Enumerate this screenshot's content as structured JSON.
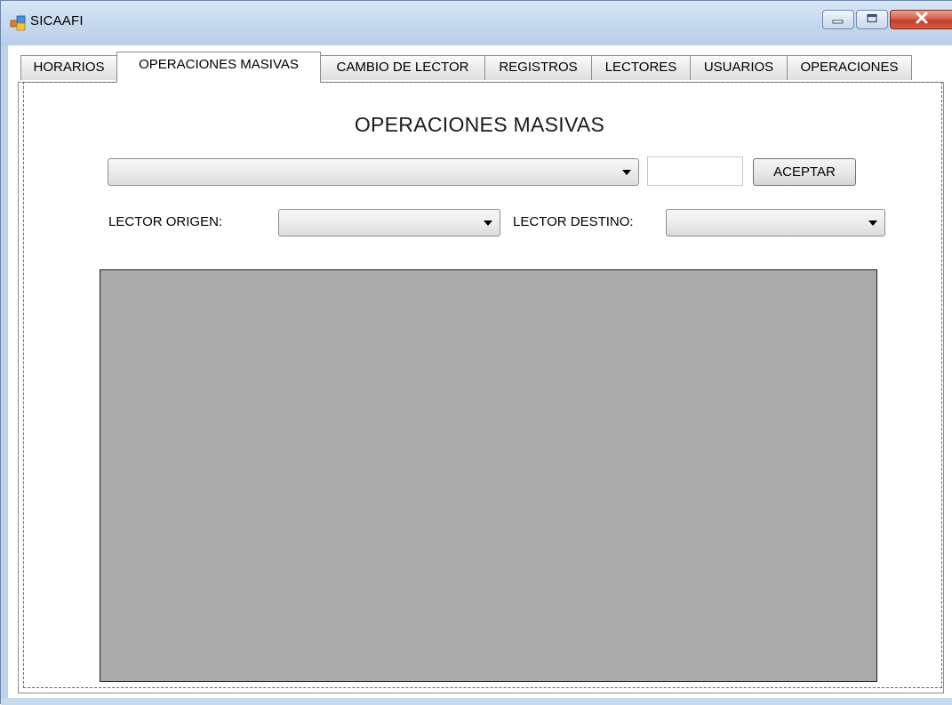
{
  "window": {
    "title": "SICAAFI",
    "controls": {
      "minimize": "minimize",
      "maximize": "maximize",
      "close": "close"
    }
  },
  "tabs": [
    {
      "label": "HORARIOS",
      "active": false
    },
    {
      "label": "OPERACIONES MASIVAS",
      "active": true
    },
    {
      "label": "CAMBIO DE LECTOR",
      "active": false
    },
    {
      "label": "REGISTROS",
      "active": false
    },
    {
      "label": "LECTORES",
      "active": false
    },
    {
      "label": "USUARIOS",
      "active": false
    },
    {
      "label": "OPERACIONES",
      "active": false
    }
  ],
  "page": {
    "heading": "OPERACIONES MASIVAS",
    "operation_select": {
      "value": ""
    },
    "value_input": {
      "value": ""
    },
    "accept_label": "ACEPTAR",
    "origin_label": "LECTOR ORIGEN:",
    "origin_select": {
      "value": ""
    },
    "destination_label": "LECTOR DESTINO:",
    "destination_select": {
      "value": ""
    }
  },
  "icons": {
    "app": "app-window-icon",
    "dropdown": "chevron-down-icon"
  },
  "colors": {
    "titlebar": "#c6d9ee",
    "close_button": "#c9442f",
    "grid_background": "#ababab"
  }
}
